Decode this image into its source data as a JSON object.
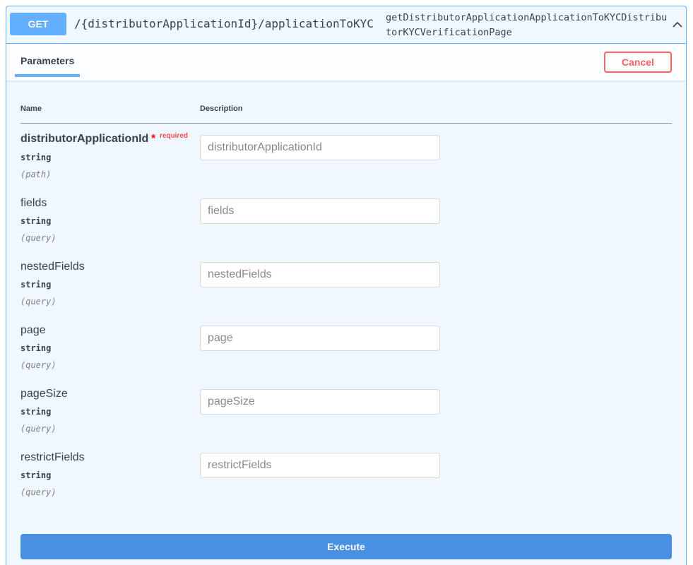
{
  "operation": {
    "method": "GET",
    "path": "/{distributorApplicationId}/applicationToKYC",
    "operation_id": "getDistributorApplicationApplicationToKYCDistributorKYCVerificationPage",
    "collapse_icon": "chevron-up-icon"
  },
  "tabs": {
    "parameters": "Parameters"
  },
  "buttons": {
    "cancel": "Cancel",
    "execute": "Execute"
  },
  "table": {
    "name_header": "Name",
    "description_header": "Description"
  },
  "params": [
    {
      "name": "distributorApplicationId",
      "required_mark": "*",
      "required_label": "required",
      "type": "string",
      "in": "(path)",
      "placeholder": "distributorApplicationId"
    },
    {
      "name": "fields",
      "type": "string",
      "in": "(query)",
      "placeholder": "fields"
    },
    {
      "name": "nestedFields",
      "type": "string",
      "in": "(query)",
      "placeholder": "nestedFields"
    },
    {
      "name": "page",
      "type": "string",
      "in": "(query)",
      "placeholder": "page"
    },
    {
      "name": "pageSize",
      "type": "string",
      "in": "(query)",
      "placeholder": "pageSize"
    },
    {
      "name": "restrictFields",
      "type": "string",
      "in": "(query)",
      "placeholder": "restrictFields"
    }
  ],
  "colors": {
    "get_accent": "#61affe",
    "cancel": "#ff6060",
    "execute": "#4990e2",
    "block_bg": "#eff7ff"
  }
}
